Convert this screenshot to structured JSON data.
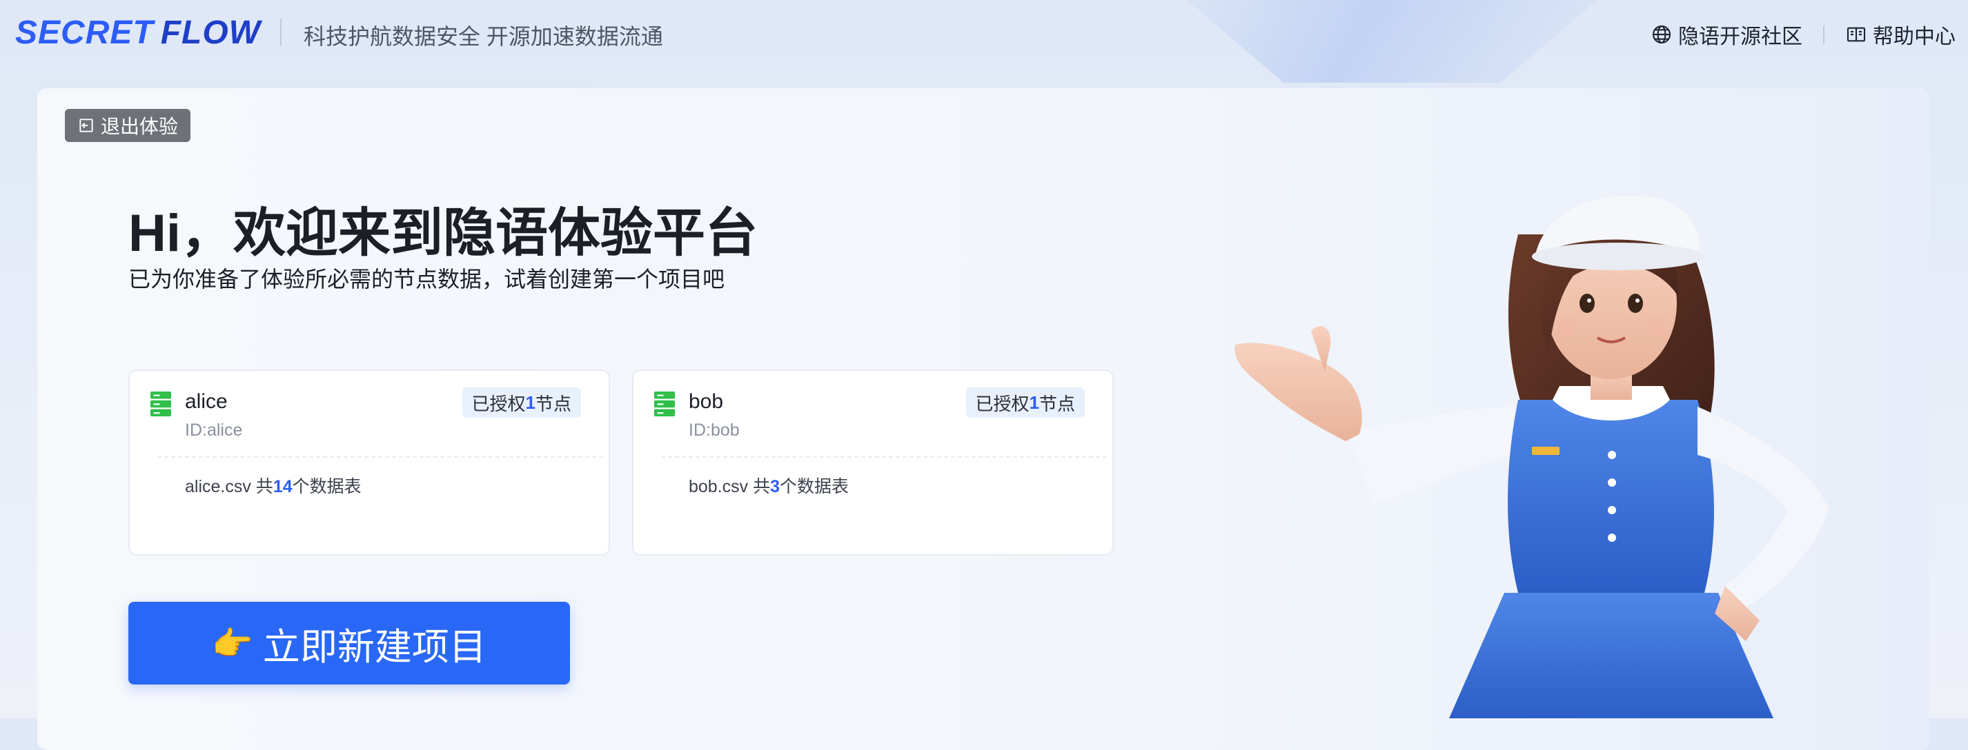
{
  "header": {
    "logo_secret": "SECRET",
    "logo_flow": "FLOW",
    "slogan": "科技护航数据安全 开源加速数据流通",
    "nav": [
      {
        "label": "隐语开源社区",
        "icon": "globe-icon"
      },
      {
        "label": "帮助中心",
        "icon": "book-icon"
      }
    ]
  },
  "main": {
    "exit_label": "退出体验",
    "title": "Hi，欢迎来到隐语体验平台",
    "subtitle": "已为你准备了体验所必需的节点数据，试着创建第一个项目吧",
    "nodes": [
      {
        "name": "alice",
        "id": "ID:alice",
        "badge_prefix": "已授权",
        "badge_count": "1",
        "badge_suffix": "节点",
        "file_prefix": "alice.csv 共",
        "file_count": "14",
        "file_suffix": "个数据表"
      },
      {
        "name": "bob",
        "id": "ID:bob",
        "badge_prefix": "已授权",
        "badge_count": "1",
        "badge_suffix": "节点",
        "file_prefix": "bob.csv 共",
        "file_count": "3",
        "file_suffix": "个数据表"
      }
    ],
    "create_emoji": "👉",
    "create_label": "立即新建项目"
  },
  "colors": {
    "brand": "#2d5cf6",
    "button": "#2968f6",
    "node_icon": "#2fbf4a",
    "exit_bg": "#6e7178"
  }
}
